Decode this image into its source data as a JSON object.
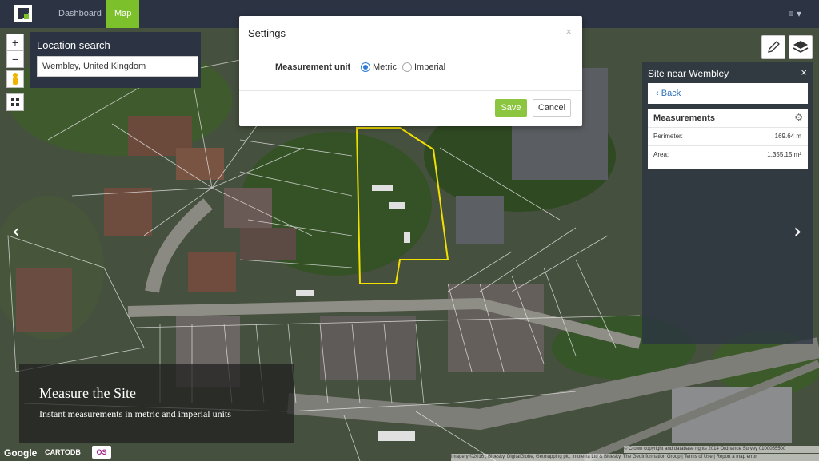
{
  "nav": {
    "logo_icon": "app-logo-icon",
    "dashboard_label": "Dashboard",
    "map_label": "Map",
    "menu_icon": "≡ ▾",
    "accent": "#7cc02b",
    "bar_color": "#2c3443"
  },
  "map_controls": {
    "zoom_in": "+",
    "zoom_out": "−",
    "pegman_icon": "pegman-icon",
    "grid_icon": "grid-icon"
  },
  "location_search": {
    "title": "Location search",
    "value": "Wembley, United Kingdom"
  },
  "settings_modal": {
    "title": "Settings",
    "close": "×",
    "unit_label": "Measurement unit",
    "options": [
      {
        "label": "Metric",
        "selected": true
      },
      {
        "label": "Imperial",
        "selected": false
      }
    ],
    "save_label": "Save",
    "cancel_label": "Cancel"
  },
  "tools": {
    "pencil_icon": "pencil-icon",
    "layers_icon": "layers-icon"
  },
  "site_panel": {
    "title": "Site near Wembley",
    "close": "×",
    "back_label": "Back",
    "measurements_title": "Measurements",
    "gear_icon": "gear-icon",
    "rows": [
      {
        "key": "Perimeter:",
        "value": "169.64 m"
      },
      {
        "key": "Area:",
        "value": "1,355.15 m²"
      }
    ]
  },
  "carousel": {
    "prev_icon": "chevron-left-icon",
    "next_icon": "chevron-right-icon",
    "prev": "‹",
    "next": "›"
  },
  "caption": {
    "title": "Measure the Site",
    "subtitle": "Instant measurements in metric and imperial units"
  },
  "footer": {
    "google": "Google",
    "cartodb": "CARTODB",
    "os": "OS",
    "attribution_top": "© Crown copyright and database rights 2014 Ordnance Survey 0100055500",
    "attribution_bottom": "Imagery ©2016 , Bluesky, DigitalGlobe, Getmapping plc, Infoterra Ltd & Bluesky, The GeoInformation Group | Terms of Use | Report a map error"
  }
}
